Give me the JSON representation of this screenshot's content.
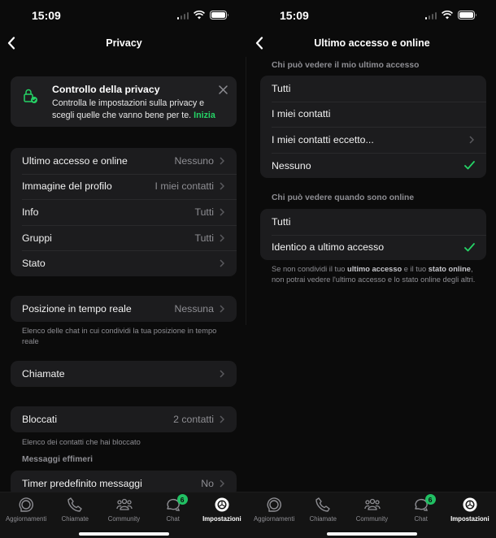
{
  "colors": {
    "accent": "#25d366",
    "badge": "#21c063",
    "background": "#0b0b0b",
    "card": "#1c1c1e",
    "secondary_text": "#8e8e93"
  },
  "status_bar": {
    "time": "15:09"
  },
  "left": {
    "nav": {
      "title": "Privacy",
      "back_icon": "chevron-left-icon"
    },
    "banner": {
      "icon": "lock-check-icon",
      "title": "Controllo della privacy",
      "text": "Controlla le impostazioni sulla privacy e scegli quelle che vanno bene per te.",
      "link": "Inizia",
      "close_icon": "close-icon"
    },
    "group1": [
      {
        "label": "Ultimo accesso e online",
        "value": "Nessuno"
      },
      {
        "label": "Immagine del profilo",
        "value": "I miei contatti"
      },
      {
        "label": "Info",
        "value": "Tutti"
      },
      {
        "label": "Gruppi",
        "value": "Tutti"
      },
      {
        "label": "Stato",
        "value": ""
      }
    ],
    "live_location": {
      "label": "Posizione in tempo reale",
      "value": "Nessuna"
    },
    "live_location_note": "Elenco delle chat in cui condividi la tua posizione in tempo reale",
    "calls": {
      "label": "Chiamate",
      "value": ""
    },
    "blocked": {
      "label": "Bloccati",
      "value": "2 contatti"
    },
    "blocked_note": "Elenco dei contatti che hai bloccato",
    "ephemeral_header": "Messaggi effimeri",
    "timer": {
      "label": "Timer predefinito messaggi",
      "value": "No"
    }
  },
  "right": {
    "nav": {
      "title": "Ultimo accesso e online",
      "back_icon": "chevron-left-icon"
    },
    "last_seen_header": "Chi può vedere il mio ultimo accesso",
    "last_seen_options": [
      {
        "label": "Tutti",
        "selected": false,
        "chevron": false
      },
      {
        "label": "I miei contatti",
        "selected": false,
        "chevron": false
      },
      {
        "label": "I miei contatti eccetto...",
        "selected": false,
        "chevron": true
      },
      {
        "label": "Nessuno",
        "selected": true,
        "chevron": false
      }
    ],
    "online_header": "Chi può vedere quando sono online",
    "online_options": [
      {
        "label": "Tutti",
        "selected": false
      },
      {
        "label": "Identico a ultimo accesso",
        "selected": true
      }
    ],
    "note": {
      "p1": "Se non condividi il tuo ",
      "b1": "ultimo accesso",
      "p2": " e il tuo ",
      "b2": "stato online",
      "p3": ", non potrai vedere l'ultimo accesso e lo stato online degli altri."
    }
  },
  "tab_bar": {
    "tabs": [
      {
        "label": "Aggiornamenti",
        "icon": "updates-icon",
        "active": false
      },
      {
        "label": "Chiamate",
        "icon": "phone-icon",
        "active": false
      },
      {
        "label": "Community",
        "icon": "community-icon",
        "active": false
      },
      {
        "label": "Chat",
        "icon": "chat-icon",
        "active": false,
        "badge": "6"
      },
      {
        "label": "Impostazioni",
        "icon": "settings-icon",
        "active": true
      }
    ]
  }
}
